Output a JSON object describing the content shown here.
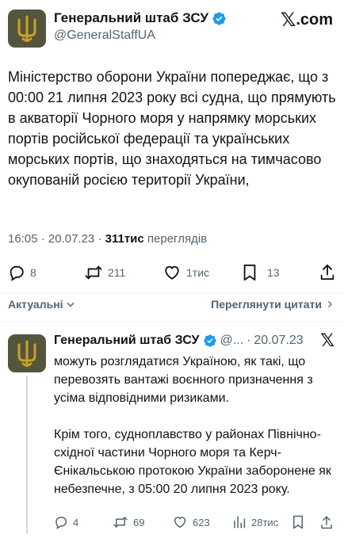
{
  "colors": {
    "avatar_bg": "#55543d",
    "emblem": "#c9a227",
    "verified": "#1d9bf0",
    "secondary_text": "#536471"
  },
  "header": {
    "name": "Генеральний штаб ЗСУ",
    "handle": "@GeneralStaffUA",
    "brand": ".com",
    "brand_icon": "x-logo-icon"
  },
  "tweet": {
    "text": "Міністерство оборони України попереджає, що з 00:00 21 липня 2023 року всі судна, що прямують в акваторії Чорного моря у напрямку морських портів російської федерації та українських морських портів, що знаходяться на тимчасово окупованій росією території України,",
    "time": "16:05",
    "date": "20.07.23",
    "views_count": "311тис",
    "views_label": "переглядів",
    "sep": "·"
  },
  "actions": {
    "replies": "8",
    "retweets": "211",
    "likes": "1тис",
    "bookmarks": "13"
  },
  "filter": {
    "relevant_label": "Актуальні",
    "quotes_label": "Переглянути цитати"
  },
  "reply": {
    "name": "Генеральний штаб ЗСУ",
    "handle": "@...",
    "date": "20.07.23",
    "sep": "·",
    "paragraph1": "можуть розглядатися Україною, як такі, що перевозять вантажі воєнного призначення з усіма відповідними ризиками.",
    "paragraph2": "Крім того, судноплавство у районах Північно-східної частини Чорного моря та Керч-Єнікальською протокою України заборонене як небезпечне, з 05:00 20 липня 2023 року.",
    "replies": "4",
    "retweets": "69",
    "likes": "623",
    "views": "28тис"
  }
}
